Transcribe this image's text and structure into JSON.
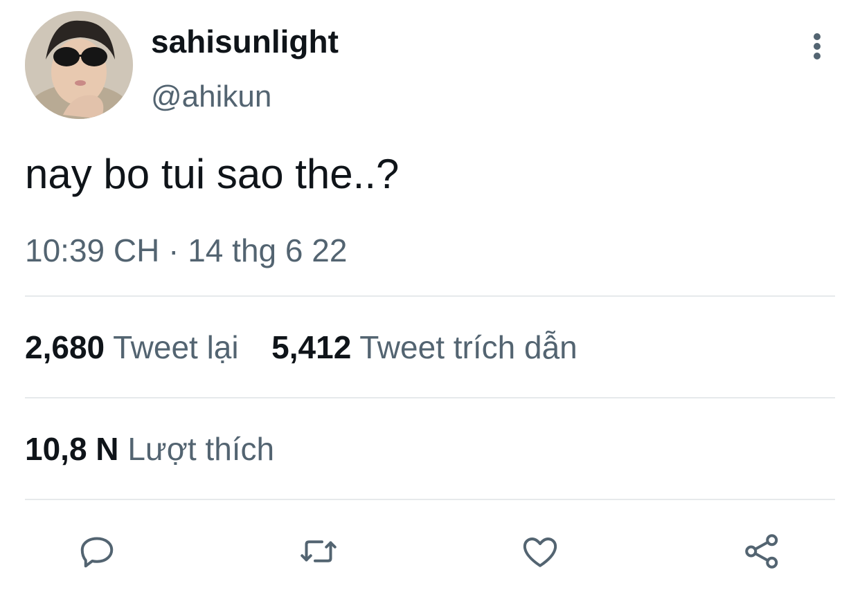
{
  "tweet": {
    "display_name": "sahisunlight",
    "handle": "@ahikun",
    "text": "nay bo tui sao the..?",
    "timestamp": "10:39 CH · 14 thg 6 22"
  },
  "stats": {
    "retweets_count": "2,680",
    "retweets_label": "Tweet lại",
    "quotes_count": "5,412",
    "quotes_label": "Tweet trích dẫn",
    "likes_count": "10,8 N",
    "likes_label": "Lượt thích"
  },
  "icons": {
    "more": "more-vertical-icon",
    "reply": "reply-icon",
    "retweet": "retweet-icon",
    "like": "heart-icon",
    "share": "share-icon"
  },
  "colors": {
    "text_primary": "#0f1419",
    "text_secondary": "#536471",
    "divider": "#e6e9eb",
    "icon": "#536471"
  }
}
